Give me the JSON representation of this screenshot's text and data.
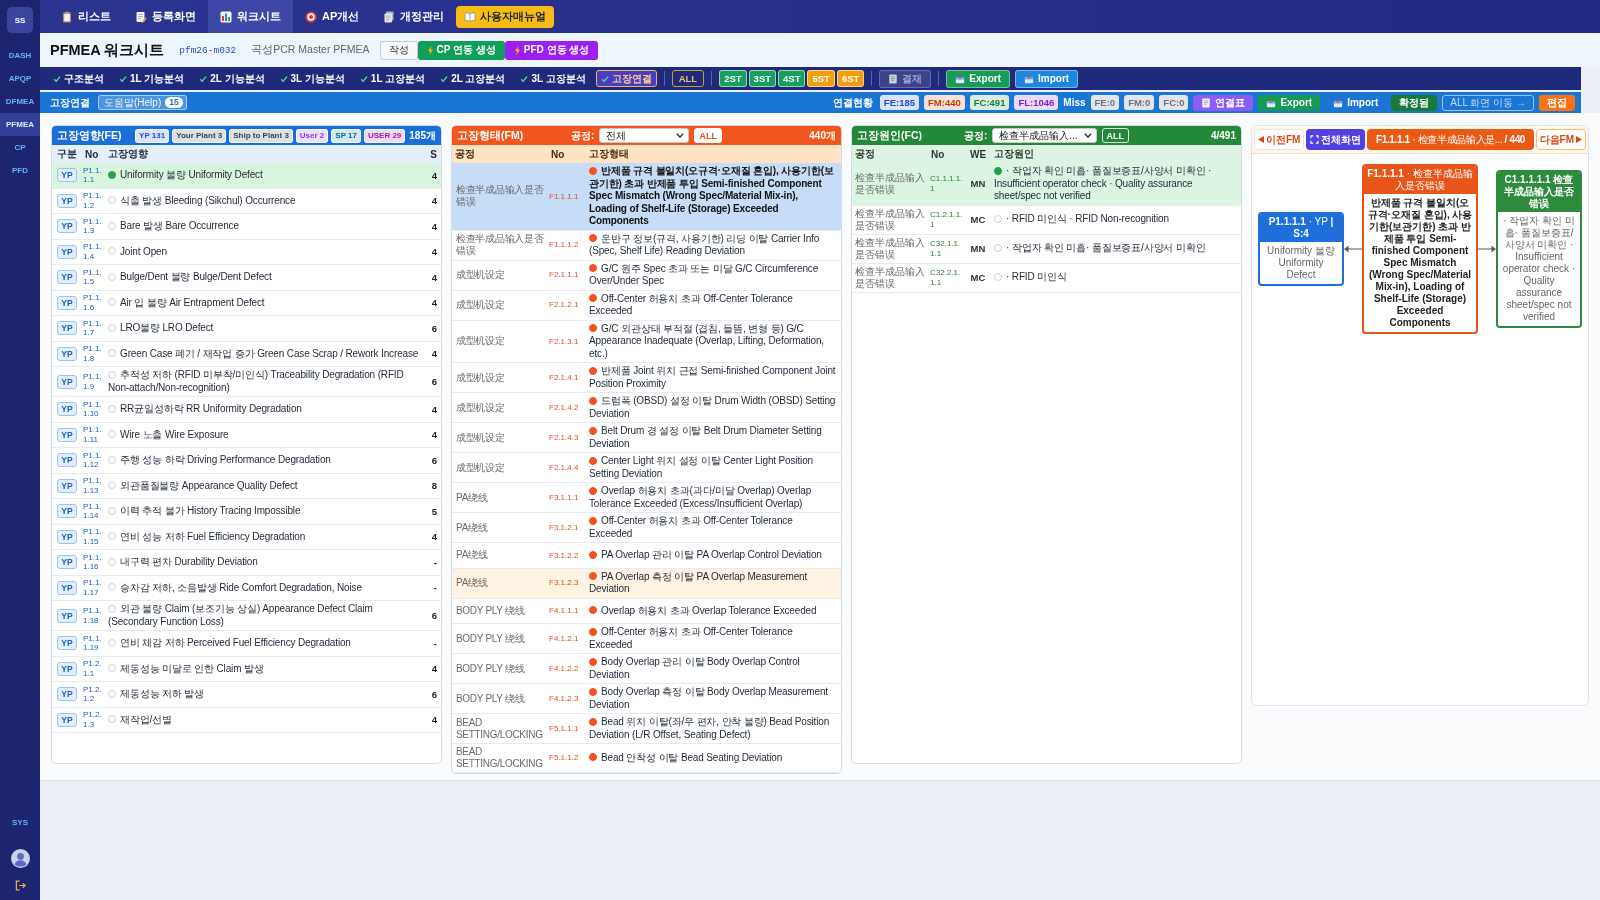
{
  "sidebar": {
    "logo": "SS",
    "items": [
      {
        "label": "DASH",
        "selected": false
      },
      {
        "label": "APQP",
        "selected": false
      },
      {
        "label": "DFMEA",
        "selected": false
      },
      {
        "label": "PFMEA",
        "selected": true
      },
      {
        "label": "CP",
        "selected": false
      },
      {
        "label": "PFD",
        "selected": false
      }
    ],
    "bottom_items": [
      {
        "label": "SYS",
        "selected": false
      }
    ]
  },
  "top_nav": {
    "tabs": [
      {
        "label": "리스트",
        "selected": false
      },
      {
        "label": "등록화면",
        "selected": false
      },
      {
        "label": "워크시트",
        "selected": true
      },
      {
        "label": "AP개선",
        "selected": false
      },
      {
        "label": "개정관리",
        "selected": false
      }
    ],
    "manual_button": "사용자매뉴얼"
  },
  "title_bar": {
    "title": "PFMEA 워크시트",
    "doc_id": "pfm26-m032",
    "subtitle": "곡성PCR Master PFMEA",
    "buttons": [
      {
        "label": "작성",
        "kind": "outline"
      },
      {
        "label": "CP 연동 생성",
        "kind": "bolt",
        "color": "#0f9f59"
      },
      {
        "label": "PFD 연동 생성",
        "kind": "bolt",
        "color": "#9b1ff0"
      }
    ]
  },
  "step_toolbar": {
    "steps": [
      {
        "label": "구조분석",
        "done": true,
        "selected": false
      },
      {
        "label": "1L 기능분석",
        "done": true,
        "selected": false
      },
      {
        "label": "2L 기능분석",
        "done": true,
        "selected": false
      },
      {
        "label": "3L 기능분석",
        "done": true,
        "selected": false
      },
      {
        "label": "1L 고장분석",
        "done": true,
        "selected": false
      },
      {
        "label": "2L 고장분석",
        "done": true,
        "selected": false
      },
      {
        "label": "3L 고장분석",
        "done": true,
        "selected": false
      },
      {
        "label": "고장연결",
        "done": true,
        "selected": true
      }
    ],
    "filter_button": "ALL",
    "stage_buttons": [
      {
        "label": "2ST",
        "color": "#17a05d"
      },
      {
        "label": "3ST",
        "color": "#17a05d"
      },
      {
        "label": "4ST",
        "color": "#17a05d"
      },
      {
        "label": "5ST",
        "color": "#f59e0b"
      },
      {
        "label": "6ST",
        "color": "#f59e0b"
      }
    ],
    "approval_button": {
      "label": "결재",
      "disabled": true
    },
    "transfer_buttons": [
      {
        "label": "Export",
        "color": "#169c57"
      },
      {
        "label": "Import",
        "color": "#1f86e0"
      }
    ]
  },
  "link_bar": {
    "title": "고장연결",
    "help_button": {
      "label": "도움말(Help)",
      "count": "15"
    },
    "status_label": "연결현황",
    "counts": [
      {
        "text": "FE:185",
        "color": "#1d4ed8"
      },
      {
        "text": "FM:440",
        "color": "#c2410c"
      },
      {
        "text": "FC:491",
        "color": "#15803d"
      },
      {
        "text": "FL:1046",
        "color": "#7e22ce"
      }
    ],
    "miss_label": "Miss",
    "miss_counts": [
      "FE:0",
      "FM:0",
      "FC:0"
    ],
    "actions": [
      {
        "label": "연결표",
        "kind": "doc",
        "color": "#8b5cf6"
      },
      {
        "label": "Export",
        "kind": "tray",
        "color": "#149a52"
      },
      {
        "label": "Import",
        "kind": "tray"
      },
      {
        "label": "확정됨",
        "kind": "plain",
        "color": "#177a36"
      },
      {
        "label": "ALL 화면 이동 →",
        "kind": "outline"
      },
      {
        "label": "편집",
        "kind": "plain",
        "color": "#f97316"
      }
    ]
  },
  "fe_panel": {
    "title": "고장영향(FE)",
    "badges": [
      {
        "text": "YP 131",
        "color": "#1d4ed8"
      },
      {
        "text": "Your Plant 3",
        "color": "#334155"
      },
      {
        "text": "Ship to Plant 3",
        "color": "#334155"
      },
      {
        "text": "User 2",
        "color": "#9333ea"
      },
      {
        "text": "SP 17",
        "color": "#0369a1"
      },
      {
        "text": "USER 29",
        "color": "#a21caf"
      }
    ],
    "count": "185개",
    "columns": [
      "구분",
      "No",
      "고장영향",
      "S"
    ],
    "rows": [
      {
        "category": "YP",
        "no": "P1.1.1.1",
        "effect": "Uniformity 불량 Uniformity Defect",
        "severity": "4",
        "linked": true,
        "selected": true
      },
      {
        "category": "YP",
        "no": "P1.1.1.2",
        "effect": "식출 발생 Bleeding (Sikchul) Occurrence",
        "severity": "4",
        "linked": false,
        "selected": false
      },
      {
        "category": "YP",
        "no": "P1.1.1.3",
        "effect": "Bare 발생 Bare Occurrence",
        "severity": "4",
        "linked": false,
        "selected": false
      },
      {
        "category": "YP",
        "no": "P1.1.1.4",
        "effect": "Joint Open",
        "severity": "4",
        "linked": false,
        "selected": false
      },
      {
        "category": "YP",
        "no": "P1.1.1.5",
        "effect": "Bulge/Dent 불량 Bulge/Dent Defect",
        "severity": "4",
        "linked": false,
        "selected": false
      },
      {
        "category": "YP",
        "no": "P1.1.1.6",
        "effect": "Air 입 불량 Air Entrapment Defect",
        "severity": "4",
        "linked": false,
        "selected": false
      },
      {
        "category": "YP",
        "no": "P1.1.1.7",
        "effect": "LRO불량 LRO Defect",
        "severity": "6",
        "linked": false,
        "selected": false
      },
      {
        "category": "YP",
        "no": "P1.1.1.8",
        "effect": "Green Case 폐기 / 재작업 증가 Green Case Scrap / Rework Increase",
        "severity": "4",
        "linked": false,
        "selected": false
      },
      {
        "category": "YP",
        "no": "P1.1.1.9",
        "effect": "추적성 저하 (RFID 미부착/미인식) Traceability Degradation (RFID Non-attach/Non-recognition)",
        "severity": "6",
        "linked": false,
        "selected": false
      },
      {
        "category": "YP",
        "no": "P1.1.1.10",
        "effect": "RR균일성하락 RR Uniformity Degradation",
        "severity": "4",
        "linked": false,
        "selected": false
      },
      {
        "category": "YP",
        "no": "P1.1.1.11",
        "effect": "Wire 노출 Wire Exposure",
        "severity": "4",
        "linked": false,
        "selected": false
      },
      {
        "category": "YP",
        "no": "P1.1.1.12",
        "effect": "주행 성능 하락 Driving Performance Degradation",
        "severity": "6",
        "linked": false,
        "selected": false
      },
      {
        "category": "YP",
        "no": "P1.1.1.13",
        "effect": "외관품질불량 Appearance Quality Defect",
        "severity": "8",
        "linked": false,
        "selected": false
      },
      {
        "category": "YP",
        "no": "P1.1.1.14",
        "effect": "이력 추적 불가 History Tracing Impossible",
        "severity": "5",
        "linked": false,
        "selected": false
      },
      {
        "category": "YP",
        "no": "P1.1.1.15",
        "effect": "연비 성능 저하 Fuel Efficiency Degradation",
        "severity": "4",
        "linked": false,
        "selected": false
      },
      {
        "category": "YP",
        "no": "P1.1.1.16",
        "effect": "내구력 편차 Durability Deviation",
        "severity": "-",
        "linked": false,
        "selected": false
      },
      {
        "category": "YP",
        "no": "P1.1.1.17",
        "effect": "승차감 저하, 소음발생 Ride Comfort Degradation, Noise",
        "severity": "-",
        "linked": false,
        "selected": false
      },
      {
        "category": "YP",
        "no": "P1.1.1.18",
        "effect": "외관 불량 Claim (보조기능 상실) Appearance Defect Claim (Secondary Function Loss)",
        "severity": "6",
        "linked": false,
        "selected": false
      },
      {
        "category": "YP",
        "no": "P1.1.1.19",
        "effect": "연비 체감 저하 Perceived Fuel Efficiency Degradation",
        "severity": "-",
        "linked": false,
        "selected": false
      },
      {
        "category": "YP",
        "no": "P1.2.1.1",
        "effect": "제동성능 미달로 인한 Claim 발생",
        "severity": "4",
        "linked": false,
        "selected": false
      },
      {
        "category": "YP",
        "no": "P1.2.1.2",
        "effect": "제동성능 저하 발생",
        "severity": "6",
        "linked": false,
        "selected": false
      },
      {
        "category": "YP",
        "no": "P1.2.1.3",
        "effect": "재작업/선별",
        "severity": "4",
        "linked": false,
        "selected": false
      }
    ]
  },
  "fm_panel": {
    "title": "고장형태(FM)",
    "filter_label": "공정:",
    "filter_value": "전체",
    "all_button": "ALL",
    "count": "440개",
    "columns": [
      "공정",
      "No",
      "고장형태"
    ],
    "rows": [
      {
        "process": "检查半成品输入是否错误",
        "no": "F1.1.1.1",
        "mode": "반제품 규격 불일치(오규격·오재질 혼입), 사용기한(보관기한) 초과 반제품 투입 Semi-finished Component Spec Mismatch (Wrong Spec/Material Mix-in), Loading of Shelf-Life (Storage) Exceeded Components",
        "linked": true,
        "selected": true,
        "highlighted": false
      },
      {
        "process": "检查半成品输入是否错误",
        "no": "F1.1.1.2",
        "mode": "운반구 정보(규격, 사용기한) 리딩 이탈 Carrier Info (Spec, Shelf Life) Reading Deviation",
        "linked": true,
        "selected": false,
        "highlighted": false
      },
      {
        "process": "成型机设定",
        "no": "F2.1.1.1",
        "mode": "G/C 원주 Spec 초과 또는 미달 G/C Circumference Over/Under Spec",
        "linked": true,
        "selected": false,
        "highlighted": false
      },
      {
        "process": "成型机设定",
        "no": "F2.1.2.1",
        "mode": "Off-Center 허용치 초과 Off-Center Tolerance Exceeded",
        "linked": true,
        "selected": false,
        "highlighted": false
      },
      {
        "process": "成型机设定",
        "no": "F2.1.3.1",
        "mode": "G/C 외관상태 부적절 (겹침, 들뜸, 변형 등) G/C Appearance Inadequate (Overlap, Lifting, Deformation, etc.)",
        "linked": true,
        "selected": false,
        "highlighted": false
      },
      {
        "process": "成型机设定",
        "no": "F2.1.4.1",
        "mode": "반제품 Joint 위치 근접 Semi-finished Component Joint Position Proximity",
        "linked": true,
        "selected": false,
        "highlighted": false
      },
      {
        "process": "成型机设定",
        "no": "F2.1.4.2",
        "mode": "드럼폭 (OBSD) 설정 이탈 Drum Width (OBSD) Setting Deviation",
        "linked": true,
        "selected": false,
        "highlighted": false
      },
      {
        "process": "成型机设定",
        "no": "F2.1.4.3",
        "mode": "Belt Drum 경 설정 이탈 Belt Drum Diameter Setting Deviation",
        "linked": true,
        "selected": false,
        "highlighted": false
      },
      {
        "process": "成型机设定",
        "no": "F2.1.4.4",
        "mode": "Center Light 위치 설정 이탈 Center Light Position Setting Deviation",
        "linked": true,
        "selected": false,
        "highlighted": false
      },
      {
        "process": "PA绕线",
        "no": "F3.1.1.1",
        "mode": "Overlap 허용치 초과(과다/미달 Overlap) Overlap Tolerance Exceeded (Excess/Insufficient Overlap)",
        "linked": true,
        "selected": false,
        "highlighted": false
      },
      {
        "process": "PA绕线",
        "no": "F3.1.2.1",
        "mode": "Off-Center 허용치 초과 Off-Center Tolerance Exceeded",
        "linked": true,
        "selected": false,
        "highlighted": false
      },
      {
        "process": "PA绕线",
        "no": "F3.1.2.2",
        "mode": "PA Overlap 관리 이탈 PA Overlap Control Deviation",
        "linked": true,
        "selected": false,
        "highlighted": false
      },
      {
        "process": "PA绕线",
        "no": "F3.1.2.3",
        "mode": "PA Overlap 측정 이탈 PA Overlap Measurement Deviation",
        "linked": true,
        "selected": false,
        "highlighted": true
      },
      {
        "process": "BODY PLY 绕线",
        "no": "F4.1.1.1",
        "mode": "Overlap 허용치 초과 Overlap Tolerance Exceeded",
        "linked": true,
        "selected": false,
        "highlighted": false
      },
      {
        "process": "BODY PLY 绕线",
        "no": "F4.1.2.1",
        "mode": "Off-Center 허용치 초과 Off-Center Tolerance Exceeded",
        "linked": true,
        "selected": false,
        "highlighted": false
      },
      {
        "process": "BODY PLY 绕线",
        "no": "F4.1.2.2",
        "mode": "Body Overlap 관리 이탈 Body Overlap Control Deviation",
        "linked": true,
        "selected": false,
        "highlighted": false
      },
      {
        "process": "BODY PLY 绕线",
        "no": "F4.1.2.3",
        "mode": "Body Overlap 측정 이탈 Body Overlap Measurement Deviation",
        "linked": true,
        "selected": false,
        "highlighted": false
      },
      {
        "process": "BEAD SETTING/LOCKING",
        "no": "F5.1.1.1",
        "mode": "Bead 위치 이탈(좌/우 편차, 안착 불량) Bead Position Deviation (L/R Offset, Seating Defect)",
        "linked": true,
        "selected": false,
        "highlighted": false
      },
      {
        "process": "BEAD SETTING/LOCKING",
        "no": "F5.1.1.2",
        "mode": "Bead 안착성 이탈 Bead Seating Deviation",
        "linked": true,
        "selected": false,
        "highlighted": false
      }
    ]
  },
  "fc_panel": {
    "title": "고장원인(FC)",
    "filter_label": "공정:",
    "filter_value": "检查半成品输入...",
    "all_button": "ALL",
    "count": "4/491",
    "columns": [
      "공정",
      "No",
      "WE",
      "고장원인"
    ],
    "rows": [
      {
        "process": "检查半成品输入是否错误",
        "no": "C1.1.1.1.1",
        "we": "MN",
        "cause": "· 작업자 확인 미흡· 품질보증표/사양서 미확인 · Insufficient operator check · Quality assurance sheet/spec not verified",
        "linked": true,
        "selected": true
      },
      {
        "process": "检查半成品输入是否错误",
        "no": "C1.2.1.1.1",
        "we": "MC",
        "cause": "· RFID 미인식 · RFID Non-recognition",
        "linked": false,
        "selected": false
      },
      {
        "process": "检查半成品输入是否错误",
        "no": "C32.1.1.1.1",
        "we": "MN",
        "cause": "· 작업자 확인 미흡· 품질보증표/사양서 미확인",
        "linked": false,
        "selected": false
      },
      {
        "process": "检查半成品输入是否错误",
        "no": "C32.2.1.1.1",
        "we": "MC",
        "cause": "· RFID 미인식",
        "linked": false,
        "selected": false
      }
    ]
  },
  "diagram": {
    "nav": {
      "prev": "이전FM",
      "fullscreen": "전체화면",
      "current": "**F1.1.1.1** · 检查半成品输入是... **/ 440**",
      "next": "다음FM"
    },
    "nodes": [
      {
        "kind": "fe",
        "header": "**P1.1.1.1** · YP **| S:4**",
        "body": "Uniformity 불량 Uniformity Defect"
      },
      {
        "kind": "fm",
        "header": "**F1.1.1.1** · 检查半成品输入是否错误",
        "body": "반제품 규격 불일치(오규격·오재질 혼입), 사용기한(보관기한) 초과 반제품 투입 Semi-finished Component Spec Mismatch (Wrong Spec/Material Mix-in), Loading of Shelf-Life (Storage) Exceeded Components"
      },
      {
        "kind": "fc",
        "header": "C1.1.1.1.1 检查半成品输入是否错误",
        "body": "· 작업자 확인 미흡· 품질보증표/사양서 미확인 · Insufficient operator check · Quality assurance sheet/spec not verified"
      }
    ]
  }
}
